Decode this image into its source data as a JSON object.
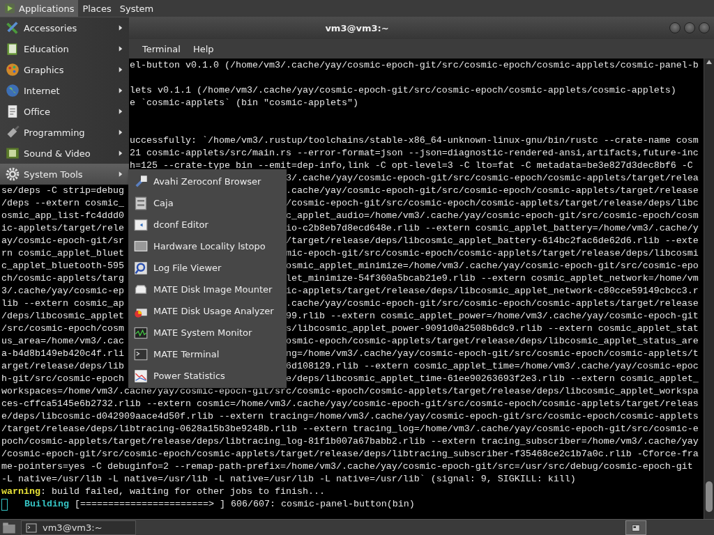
{
  "top_panel": {
    "menus": [
      {
        "label": "Applications",
        "selected": true
      },
      {
        "label": "Places",
        "selected": false
      },
      {
        "label": "System",
        "selected": false
      }
    ]
  },
  "window": {
    "title": "vm3@vm3:~",
    "menubar": [
      "Terminal",
      "Help"
    ]
  },
  "terminal": {
    "lines": [
      {
        "kind": "after_menu",
        "text": "el-button v0.1.0 (/home/vm3/.cache/yay/cosmic-epoch-git/src/cosmic-epoch/cosmic-applets/cosmic-panel-b"
      },
      {
        "kind": "blank"
      },
      {
        "kind": "after_menu",
        "text": "lets v0.1.1 (/home/vm3/.cache/yay/cosmic-epoch-git/src/cosmic-epoch/cosmic-applets/cosmic-applets)"
      },
      {
        "kind": "after_menu",
        "text": "e `cosmic-applets` (bin \"cosmic-applets\")"
      },
      {
        "kind": "blank"
      },
      {
        "kind": "blank"
      },
      {
        "kind": "after_menu",
        "text": "uccessfully: `/home/vm3/.rustup/toolchains/stable-x86_64-unknown-linux-gnu/bin/rustc --crate-name cosm"
      },
      {
        "kind": "after_menu",
        "text": "21 cosmic-applets/src/main.rs --error-format=json --json=diagnostic-rendered-ansi,artifacts,future-inc"
      },
      {
        "kind": "after_menu",
        "text": "h=125 --crate-type bin --emit=dep-info,link -C opt-level=3 -C lto=fat -C metadata=be3e827d3dec8bf6 -C"
      },
      {
        "kind": "right",
        "text": "3/.cache/yay/cosmic-epoch-git/src/cosmic-epoch/cosmic-applets/target/relea"
      },
      {
        "kind": "split",
        "left": "se/deps -C strip=debug",
        "right": ".cache/yay/cosmic-epoch-git/src/cosmic-epoch/cosmic-applets/target/release"
      },
      {
        "kind": "split",
        "left": "/deps --extern cosmic_",
        "right": "/cosmic-epoch-git/src/cosmic-epoch/cosmic-applets/target/release/deps/libc"
      },
      {
        "kind": "split",
        "left": "osmic_app_list-fc4ddd0",
        "right": "c_applet_audio=/home/vm3/.cache/yay/cosmic-epoch-git/src/cosmic-epoch/cosm"
      },
      {
        "kind": "split",
        "left": "ic-applets/target/rele",
        "right": "io-c2b8eb7d8ecd648e.rlib --extern cosmic_applet_battery=/home/vm3/.cache/y"
      },
      {
        "kind": "split",
        "left": "ay/cosmic-epoch-git/sr",
        "right": "/target/release/deps/libcosmic_applet_battery-614bc2fac6de62d6.rlib --exte"
      },
      {
        "kind": "split",
        "left": "rn cosmic_applet_bluet",
        "right": "mic-epoch-git/src/cosmic-epoch/cosmic-applets/target/release/deps/libcosmi"
      },
      {
        "kind": "split",
        "left": "c_applet_bluetooth-595",
        "right": "osmic_applet_minimize=/home/vm3/.cache/yay/cosmic-epoch-git/src/cosmic-epo"
      },
      {
        "kind": "split",
        "left": "ch/cosmic-applets/targ",
        "right": "let_minimize-54f360a5bcab21e9.rlib --extern cosmic_applet_network=/home/vm"
      },
      {
        "kind": "split",
        "left": "3/.cache/yay/cosmic-ep",
        "right": "ic-applets/target/release/deps/libcosmic_applet_network-c80cce59149cbcc3.r"
      },
      {
        "kind": "split",
        "left": "lib --extern cosmic_ap",
        "right": ".cache/yay/cosmic-epoch-git/src/cosmic-epoch/cosmic-applets/target/release"
      },
      {
        "kind": "split",
        "left": "/deps/libcosmic_applet",
        "right": "99.rlib --extern cosmic_applet_power=/home/vm3/.cache/yay/cosmic-epoch-git"
      },
      {
        "kind": "split",
        "left": "/src/cosmic-epoch/cosm",
        "right": "s/libcosmic_applet_power-9091d0a2508b6dc9.rlib --extern cosmic_applet_stat"
      },
      {
        "kind": "split",
        "left": "us_area=/home/vm3/.cac",
        "right": "osmic-epoch/cosmic-applets/target/release/deps/libcosmic_applet_status_are"
      },
      {
        "kind": "split",
        "left": "a-b4d8b149eb420c4f.rli",
        "right": "ng=/home/vm3/.cache/yay/cosmic-epoch-git/src/cosmic-epoch/cosmic-applets/t"
      },
      {
        "kind": "split",
        "left": "arget/release/deps/lib",
        "right": "6d108129.rlib --extern cosmic_applet_time=/home/vm3/.cache/yay/cosmic-epoc"
      },
      {
        "kind": "split",
        "left": "h-git/src/cosmic-epoch",
        "right": "e/deps/libcosmic_applet_time-61ee90263693f2e3.rlib --extern cosmic_applet_"
      },
      {
        "kind": "full",
        "text": "workspaces=/home/vm3/.cache/yay/cosmic-epoch-git/src/cosmic-epoch/cosmic-applets/target/release/deps/libcosmic_applet_workspa"
      },
      {
        "kind": "full",
        "text": "ces-cffca5145e6b2732.rlib --extern cosmic=/home/vm3/.cache/yay/cosmic-epoch-git/src/cosmic-epoch/cosmic-applets/target/releas"
      },
      {
        "kind": "full",
        "text": "e/deps/libcosmic-d042909aace4d50f.rlib --extern tracing=/home/vm3/.cache/yay/cosmic-epoch-git/src/cosmic-epoch/cosmic-applets"
      },
      {
        "kind": "full",
        "text": "/target/release/deps/libtracing-0628a15b3be9248b.rlib --extern tracing_log=/home/vm3/.cache/yay/cosmic-epoch-git/src/cosmic-e"
      },
      {
        "kind": "full",
        "text": "poch/cosmic-applets/target/release/deps/libtracing_log-81f1b007a67babb2.rlib --extern tracing_subscriber=/home/vm3/.cache/yay"
      },
      {
        "kind": "full",
        "text": "/cosmic-epoch-git/src/cosmic-epoch/cosmic-applets/target/release/deps/libtracing_subscriber-f35468ce2c1b7a0c.rlib -Cforce-fra"
      },
      {
        "kind": "full",
        "text": "me-pointers=yes -C debuginfo=2 --remap-path-prefix=/home/vm3/.cache/yay/cosmic-epoch-git/src=/usr/src/debug/cosmic-epoch-git"
      },
      {
        "kind": "full",
        "text": "-L native=/usr/lib -L native=/usr/lib -L native=/usr/lib -L native=/usr/lib` (signal: 9, SIGKILL: kill)"
      },
      {
        "kind": "warning",
        "label": "warning",
        "text": ": build failed, waiting for other jobs to finish..."
      },
      {
        "kind": "progress",
        "label": "Building",
        "text": "[=======================> ] 606/607: cosmic-panel-button(bin)"
      }
    ]
  },
  "applications_menu": {
    "items": [
      {
        "label": "Accessories",
        "selected": false
      },
      {
        "label": "Education",
        "selected": false
      },
      {
        "label": "Graphics",
        "selected": false
      },
      {
        "label": "Internet",
        "selected": false
      },
      {
        "label": "Office",
        "selected": false
      },
      {
        "label": "Programming",
        "selected": false
      },
      {
        "label": "Sound & Video",
        "selected": false
      },
      {
        "label": "System Tools",
        "selected": true
      }
    ]
  },
  "system_tools_menu": {
    "items": [
      "Avahi Zeroconf Browser",
      "Caja",
      "dconf Editor",
      "Hardware Locality lstopo",
      "Log File Viewer",
      "MATE Disk Image Mounter",
      "MATE Disk Usage Analyzer",
      "MATE System Monitor",
      "MATE Terminal",
      "Power Statistics"
    ]
  },
  "taskbar": {
    "tasks": [
      {
        "label": "vm3@vm3:~",
        "selected": false
      }
    ]
  }
}
